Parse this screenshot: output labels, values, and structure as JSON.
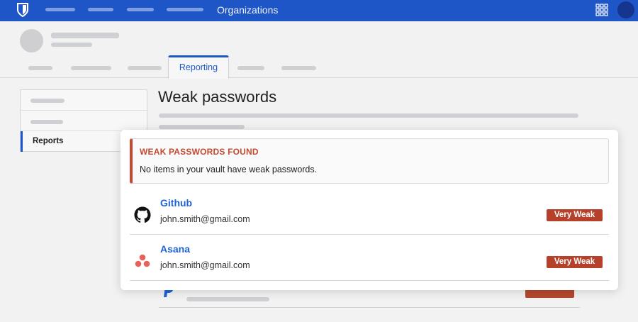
{
  "topnav": {
    "title": "Organizations",
    "colors": {
      "bar": "#1f56c7",
      "accent": "#1f56c7"
    }
  },
  "tabs": {
    "active_label": "Reporting"
  },
  "sidebar": {
    "active_label": "Reports"
  },
  "page": {
    "title": "Weak passwords"
  },
  "alert": {
    "title": "WEAK PASSWORDS FOUND",
    "message": "No items in your vault have weak passwords.",
    "color": "#c34a31"
  },
  "items": [
    {
      "name": "Github",
      "username": "john.smith@gmail.com",
      "badge": "Very Weak",
      "icon": "github-icon"
    },
    {
      "name": "Asana",
      "username": "john.smith@gmail.com",
      "badge": "Very Weak",
      "icon": "asana-icon"
    }
  ]
}
